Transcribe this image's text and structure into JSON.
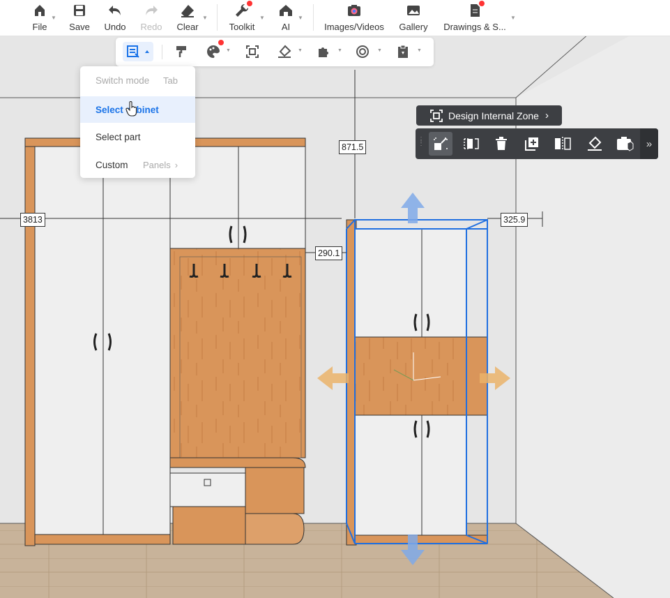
{
  "toolbar": {
    "file": "File",
    "save": "Save",
    "undo": "Undo",
    "redo": "Redo",
    "clear": "Clear",
    "toolkit": "Toolkit",
    "ai": "AI",
    "images_videos": "Images/Videos",
    "gallery": "Gallery",
    "drawings": "Drawings & S..."
  },
  "select_menu": {
    "header_label": "Switch mode",
    "header_shortcut": "Tab",
    "items": [
      {
        "label": "Select cabinet",
        "selected": true
      },
      {
        "label": "Select part",
        "selected": false
      },
      {
        "label": "Custom",
        "sub": "Panels"
      }
    ]
  },
  "dimensions": {
    "height": "871.5",
    "left_width": "3813",
    "right_gap": "325.9",
    "middle_gap": "290.1"
  },
  "cabinet_toolbar": {
    "zone_label": "Design Internal Zone",
    "more_label": "»"
  },
  "colors": {
    "accent": "#1a73e8",
    "wood": "#d9955a",
    "dark_toolbar": "#3d3f43",
    "selection": "#1f6fe0",
    "notification_dot": "#ff3333"
  }
}
